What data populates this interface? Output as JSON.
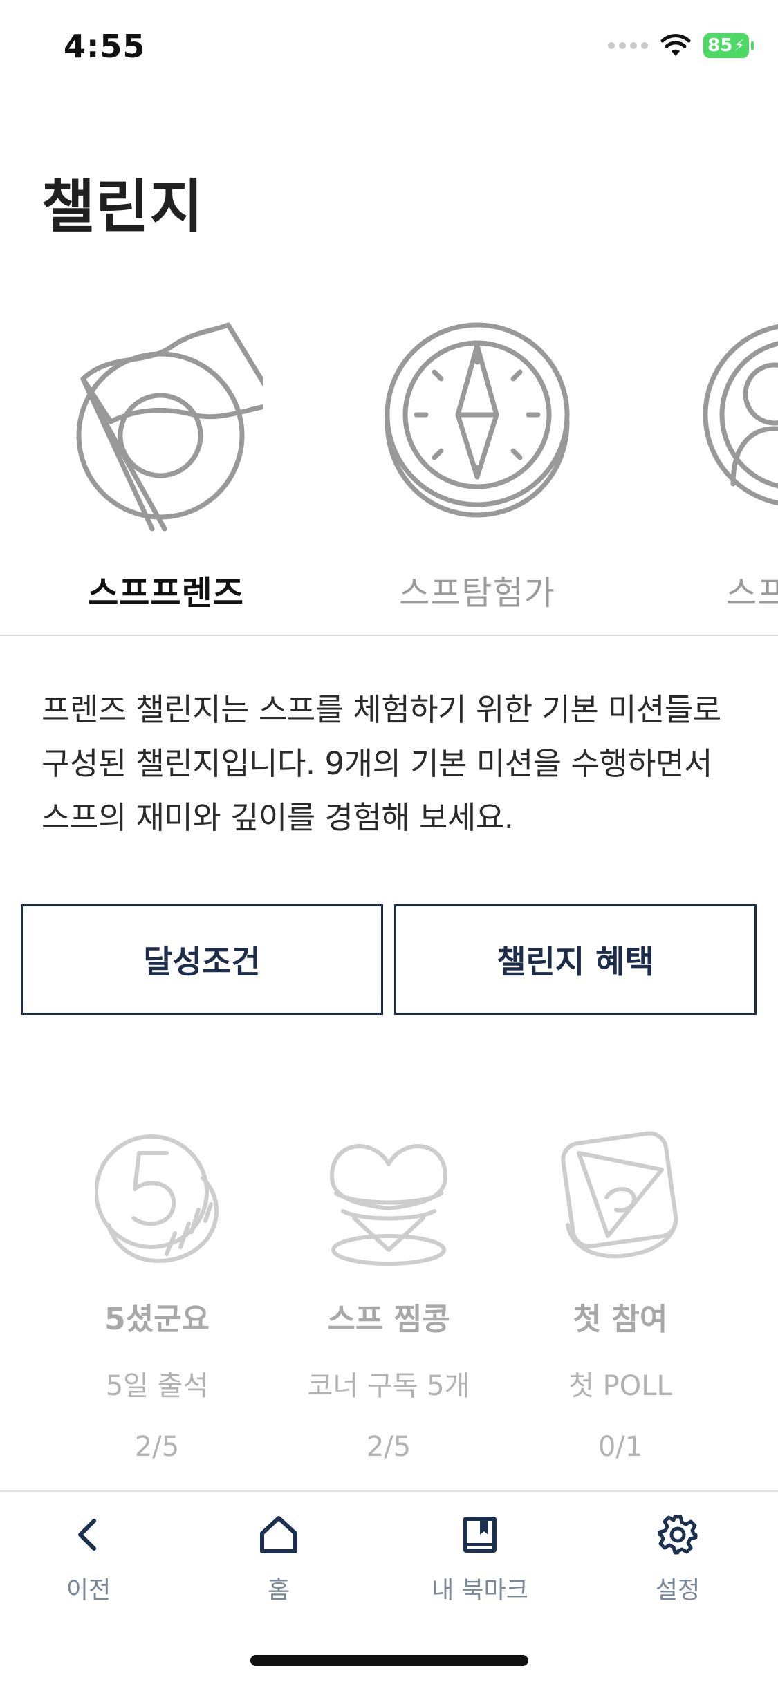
{
  "status_bar": {
    "time": "4:55",
    "battery": "85"
  },
  "page": {
    "title": "챌린지"
  },
  "carousel": {
    "items": [
      {
        "label": "스프프렌즈",
        "icon": "flag-badge-icon",
        "active": true
      },
      {
        "label": "스프탐험가",
        "icon": "compass-badge-icon",
        "active": false
      },
      {
        "label": "스프",
        "icon": "person-badge-icon",
        "active": false
      }
    ]
  },
  "description": "프렌즈 챌린지는 스프를 체험하기 위한 기본 미션들로 구성된 챌린지입니다. 9개의 기본 미션을 수행하면서 스프의 재미와 깊이를 경험해 보세요.",
  "buttons": {
    "conditions": "달성조건",
    "benefits": "챌린지 혜택"
  },
  "missions": [
    {
      "title": "5셨군요",
      "subtitle": "5일 출석",
      "progress": "2/5",
      "icon": "five-coin-icon"
    },
    {
      "title": "스프 찜콩",
      "subtitle": "코너 구독 5개",
      "progress": "2/5",
      "icon": "heart-badge-icon"
    },
    {
      "title": "첫 참여",
      "subtitle": "첫 POLL",
      "progress": "0/1",
      "icon": "poll-badge-icon"
    }
  ],
  "tab_bar": {
    "tabs": [
      {
        "label": "이전",
        "icon": "chevron-left-icon"
      },
      {
        "label": "홈",
        "icon": "home-icon"
      },
      {
        "label": "내 북마크",
        "icon": "bookmark-book-icon"
      },
      {
        "label": "설정",
        "icon": "gear-icon"
      }
    ]
  },
  "colors": {
    "navy": "#1c2c4a",
    "badge_gray": "#999999",
    "mission_gray": "#c8c8c8",
    "tab_icon": "#1c3050",
    "battery": "#4cd964"
  }
}
